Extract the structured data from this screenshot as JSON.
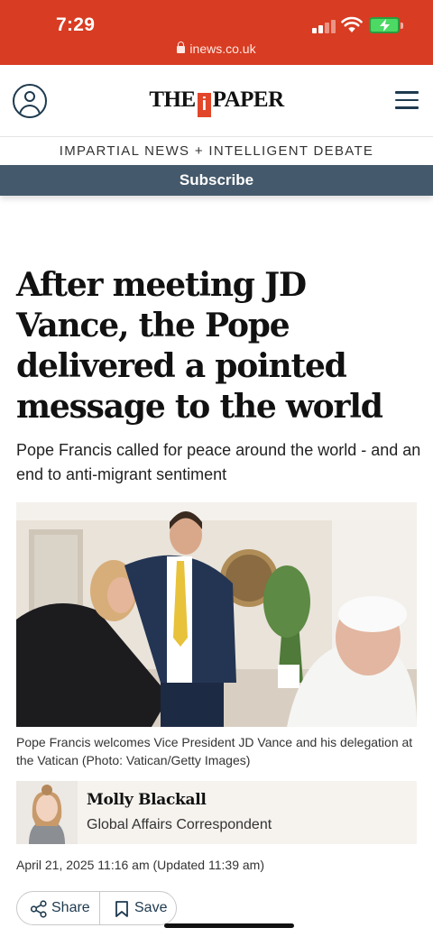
{
  "status_bar": {
    "time": "7:29",
    "url": "inews.co.uk",
    "accent_color": "#d83c22"
  },
  "header": {
    "logo_left": "THE",
    "logo_mark": "i",
    "logo_right": "PAPER",
    "account_icon": "user-circle-icon",
    "menu_icon": "hamburger-menu-icon"
  },
  "tagline": "IMPARTIAL NEWS + INTELLIGENT DEBATE",
  "subscribe_label": "Subscribe",
  "article": {
    "headline": "After meeting JD Vance, the Pope delivered a pointed message to the world",
    "standfirst": "Pope Francis called for peace around the world - and an end to anti-migrant sentiment",
    "caption": "Pope Francis welcomes Vice President JD Vance and his delegation at the Vatican (Photo: Vatican/Getty Images)",
    "author": {
      "name": "Molly Blackall",
      "role": "Global Affairs Correspondent"
    },
    "date": "April 21, 2025 11:16 am (Updated 11:39 am)"
  },
  "actions": {
    "share_label": "Share",
    "save_label": "Save"
  }
}
